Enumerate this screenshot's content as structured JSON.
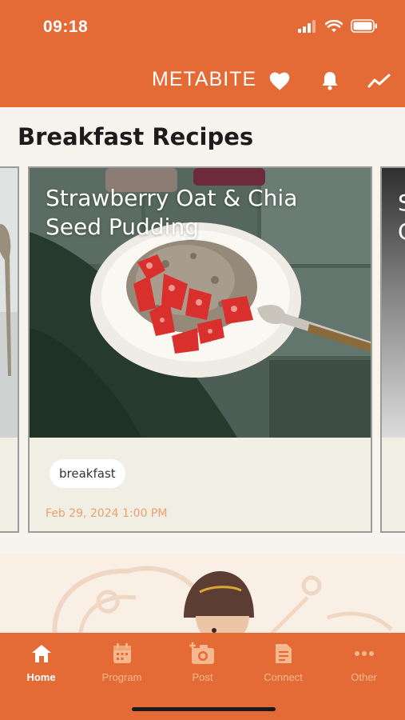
{
  "status_bar": {
    "time": "09:18"
  },
  "header": {
    "brand": "METABITE",
    "icons": [
      "heart-icon",
      "bell-icon",
      "trend-icon"
    ]
  },
  "section": {
    "title": "Breakfast Recipes"
  },
  "cards": [
    {
      "title": "Strawberry Oat & Chia Seed Pudding",
      "tag": "breakfast",
      "date": "Feb 29, 2024 1:00 PM"
    }
  ],
  "next_card": {
    "title_fragment": "S\nC"
  },
  "tabs": [
    {
      "label": "Home",
      "icon": "home-icon",
      "active": true
    },
    {
      "label": "Program",
      "icon": "calendar-icon",
      "active": false
    },
    {
      "label": "Post",
      "icon": "camera-add-icon",
      "active": false
    },
    {
      "label": "Connect",
      "icon": "document-icon",
      "active": false
    },
    {
      "label": "Other",
      "icon": "more-icon",
      "active": false
    }
  ],
  "colors": {
    "brand": "#e56b36",
    "background": "#f7f4ee",
    "card_footer": "#f1efe3",
    "date_text": "#e9a06e",
    "inactive_tab": "#f5b890"
  }
}
